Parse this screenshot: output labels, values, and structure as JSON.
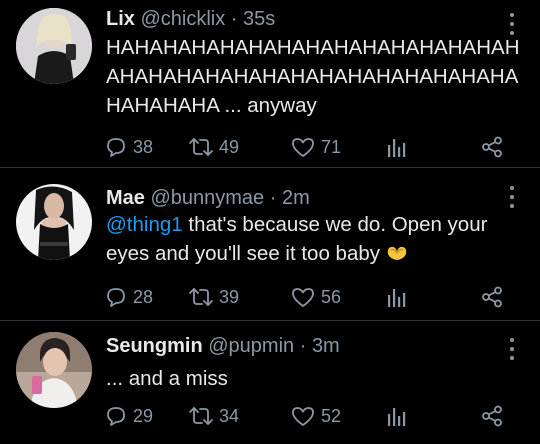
{
  "tweets": [
    {
      "name": "Lix",
      "handle": "@chicklix",
      "separator": "·",
      "time": "35s",
      "text": "HAHAHAHAHAHAHAHAHAHAHAHAHAHAHAHAHAHAHAHAHAHAHAHAHAHAHAHAHAHAHAHAHA ... anyway",
      "replies": "38",
      "retweets": "49",
      "likes": "71"
    },
    {
      "name": "Mae",
      "handle": "@bunnymae",
      "separator": "·",
      "time": "2m",
      "mention": "@thing1",
      "text": " that's because we do. Open your eyes and you'll see it too baby",
      "emoji": "heart-hands-emoji",
      "replies": "28",
      "retweets": "39",
      "likes": "56"
    },
    {
      "name": "Seungmin",
      "handle": "@pupmin",
      "separator": "·",
      "time": "3m",
      "text": "... and a miss",
      "replies": "29",
      "retweets": "34",
      "likes": "52"
    }
  ],
  "colors": {
    "background": "#000000",
    "text": "#e7e9ea",
    "muted": "#8b98a5",
    "link": "#1d9bf0",
    "divider": "#2f3336"
  },
  "icons": [
    "reply-icon",
    "retweet-icon",
    "like-icon",
    "stats-icon",
    "share-icon",
    "more-icon"
  ]
}
